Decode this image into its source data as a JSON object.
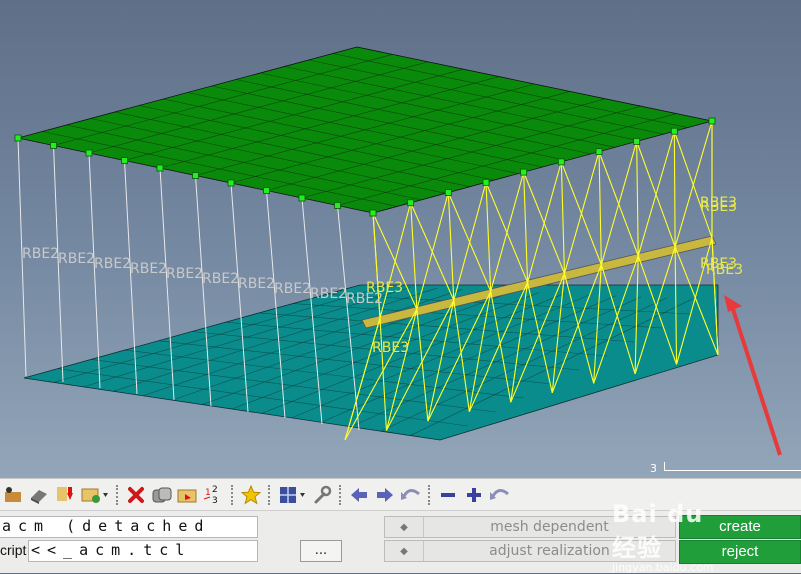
{
  "viewport": {
    "rbe2_labels": [
      "RBE2",
      "RBE2",
      "RBE2",
      "RBE2",
      "RBE2",
      "RBE2",
      "RBE2",
      "RBE2",
      "RBE2",
      "RBE2"
    ],
    "rbe3_labels": [
      "RBE3",
      "RBE3",
      "RBE3",
      "RBE3",
      "RBE3",
      "RBE3"
    ],
    "scale_value": "3",
    "colors": {
      "top_plate": "#0a8a0a",
      "bottom_plate": "#0a8c8c",
      "rbe3_lines": "#ffff2a",
      "rbe2_lines": "#e8e8e8",
      "node": "#22ee22",
      "arrow": "#e83a3a"
    }
  },
  "toolbar": {
    "icons": [
      "nodes-icon",
      "eraser-icon",
      "red-down-arrow-icon",
      "folder-dropdown-icon",
      "delete-icon",
      "copy-icon",
      "folder-icon",
      "number-icon",
      "star-icon",
      "window-grid-icon",
      "wrench-icon",
      "back-arrow-icon",
      "forward-arrow-icon",
      "undo-icon",
      "minus-icon",
      "plus-icon",
      "redo-icon"
    ]
  },
  "panel": {
    "type_value": "acm (detached",
    "script_label": "cript",
    "script_value": "<<_acm.tcl",
    "browse_label": "...",
    "toggle1": "mesh dependent",
    "toggle2": "adjust realization",
    "create_label": "create",
    "reject_label": "reject"
  },
  "watermark": {
    "brand": "Bai du 经验",
    "url": "jingyan.baidu.com"
  }
}
